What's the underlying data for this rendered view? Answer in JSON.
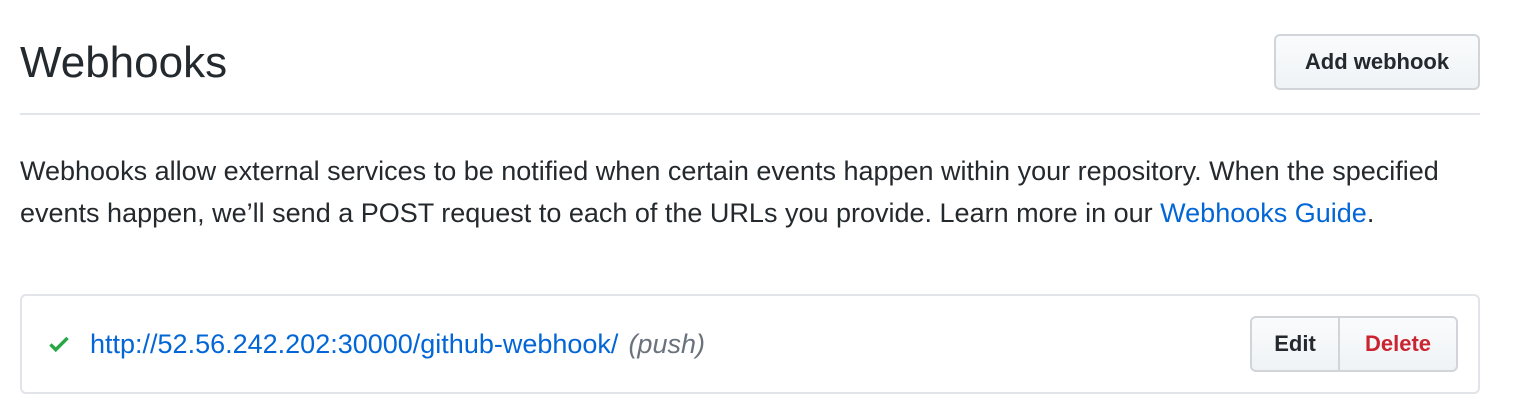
{
  "header": {
    "title": "Webhooks",
    "add_button_label": "Add webhook"
  },
  "description": {
    "text": "Webhooks allow external services to be notified when certain events happen within your repository. When the specified events happen, we’ll send a POST request to each of the URLs you provide. Learn more in our ",
    "link_text": "Webhooks Guide",
    "trailing": "."
  },
  "webhooks": [
    {
      "status_icon": "check-icon",
      "status_color": "#28a745",
      "url": "http://52.56.242.202:30000/github-webhook/",
      "events": "(push)",
      "edit_label": "Edit",
      "delete_label": "Delete"
    }
  ],
  "colors": {
    "link": "#0366d6",
    "danger": "#cb2431",
    "success": "#28a745"
  }
}
